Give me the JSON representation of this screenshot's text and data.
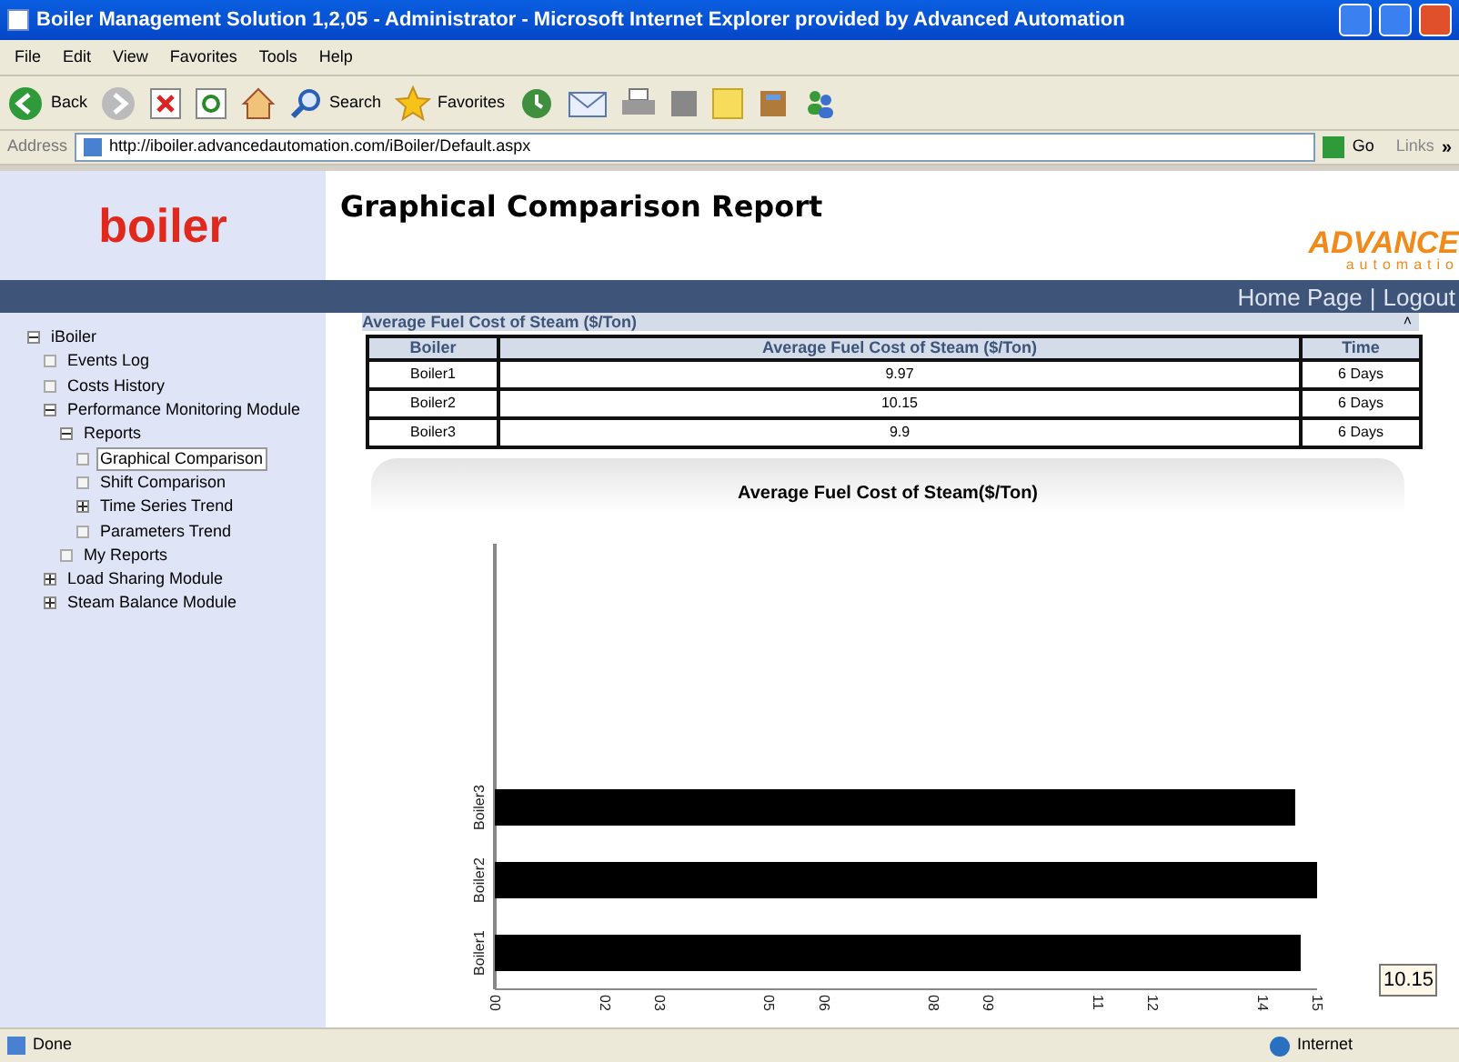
{
  "window": {
    "title": "Boiler Management Solution 1,2,05 - Administrator - Microsoft Internet Explorer provided by Advanced Automation"
  },
  "menu": [
    "File",
    "Edit",
    "View",
    "Favorites",
    "Tools",
    "Help"
  ],
  "toolbar": [
    {
      "kind": "back",
      "label": "Back"
    },
    {
      "kind": "forward"
    },
    {
      "kind": "stop"
    },
    {
      "kind": "refresh"
    },
    {
      "kind": "home"
    },
    {
      "kind": "search",
      "label": "Search"
    },
    {
      "kind": "favorites",
      "label": "Favorites"
    },
    {
      "kind": "history"
    },
    {
      "kind": "mail"
    },
    {
      "kind": "print"
    },
    {
      "kind": "edit"
    },
    {
      "kind": "note"
    },
    {
      "kind": "research"
    },
    {
      "kind": "messenger"
    }
  ],
  "address": {
    "label": "Address",
    "url": "http://iboiler.advancedautomation.com/iBoiler/Default.aspx",
    "go": "Go",
    "links": "Links",
    "more": "»"
  },
  "header": {
    "logo": "boiler",
    "title": "Graphical Comparison Report",
    "brand": "ADVANCE",
    "brand_sub": "automatio"
  },
  "nav": [
    "Home Page",
    "|",
    "Logout"
  ],
  "tree": [
    {
      "label": "iBoiler",
      "expanded": true,
      "children": [
        {
          "label": "Events Log"
        },
        {
          "label": "Costs History"
        },
        {
          "label": "Performance Monitoring Module",
          "expanded": true,
          "children": [
            {
              "label": "Reports",
              "expanded": true,
              "children": [
                {
                  "label": "Graphical Comparison",
                  "selected": true
                },
                {
                  "label": "Shift Comparison",
                  "selected": false
                },
                {
                  "label": "Time Series Trend",
                  "selected": false,
                  "expanded": false
                },
                {
                  "label": "Parameters Trend",
                  "selected": false
                }
              ]
            },
            {
              "label": "My Reports"
            }
          ]
        },
        {
          "label": "Load Sharing Module",
          "expanded": false
        },
        {
          "label": "Steam Balance Module",
          "expanded": false
        }
      ]
    }
  ],
  "panel": {
    "title": "Average Fuel Cost of Steam ($/Ton)",
    "collapse": "˄"
  },
  "table": {
    "columns": [
      "Boiler",
      "Average Fuel Cost of Steam ($/Ton)",
      "Time"
    ],
    "rows": [
      [
        "Boiler1",
        "9.97",
        "6 Days"
      ],
      [
        "Boiler2",
        "10.15",
        "6 Days"
      ],
      [
        "Boiler3",
        "9.9",
        "6 Days"
      ]
    ]
  },
  "chart": {
    "chart_data": {
      "type": "bar",
      "orientation": "horizontal",
      "title": "Average Fuel Cost of Steam($/Ton)",
      "categories": [
        "Boiler3",
        "Boiler2",
        "Boiler1"
      ],
      "values": [
        14.6,
        15,
        14.7
      ],
      "xlim": [
        0,
        15
      ],
      "xticks": [
        {
          "value": 0,
          "label": "00"
        },
        {
          "value": 2,
          "label": "02"
        },
        {
          "value": 3,
          "label": "03"
        },
        {
          "value": 5,
          "label": "05"
        },
        {
          "value": 6,
          "label": "06"
        },
        {
          "value": 8,
          "label": "08"
        },
        {
          "value": 9,
          "label": "09"
        },
        {
          "value": 11,
          "label": "11"
        },
        {
          "value": 12,
          "label": "12"
        },
        {
          "value": 14,
          "label": "14"
        },
        {
          "value": 15,
          "label": "15"
        }
      ],
      "annotations": [
        "10.15"
      ]
    }
  },
  "status_bar": {
    "left": "Done",
    "zone": "Internet"
  }
}
